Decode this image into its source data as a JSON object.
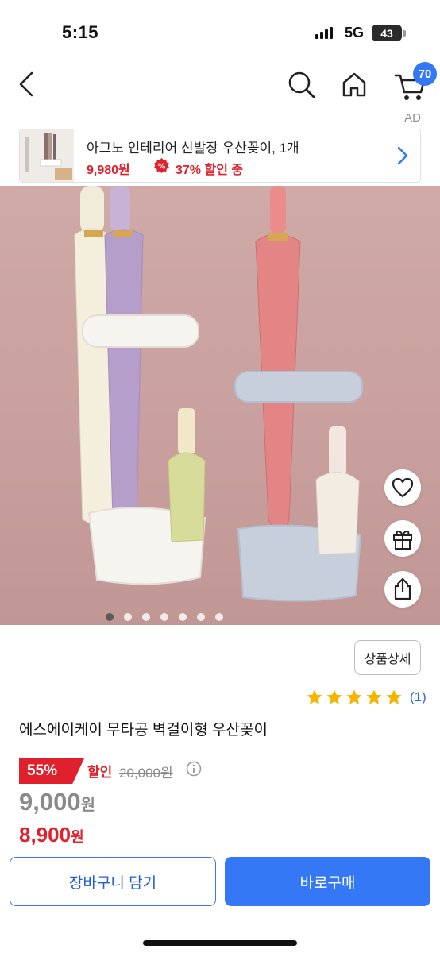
{
  "status_bar": {
    "time": "5:15",
    "network": "5G",
    "battery": "43"
  },
  "nav": {
    "cart_count": "70",
    "ad_label": "AD"
  },
  "ad_banner": {
    "title": "아그노 인테리어 신발장 우산꽂이, 1개",
    "price": "9,980원",
    "discount": "37% 할인 중"
  },
  "carousel": {
    "total_images": 7,
    "current_index": 0
  },
  "detail": {
    "detail_button_label": "상품상세",
    "rating_stars": 5,
    "rating_count": "(1)",
    "product_name": "에스에이케이 무타공 벽걸이형 우산꽂이"
  },
  "pricing": {
    "discount_rate": "55%",
    "sale_label": "할인",
    "original_price": "20,000원",
    "list_price_value": "9,000",
    "list_price_unit": "원",
    "final_price_value": "8,900",
    "final_price_unit": "원"
  },
  "bottom_bar": {
    "add_to_cart_label": "장바구니 담기",
    "buy_now_label": "바로구매"
  },
  "colors": {
    "accent_blue": "#3478f6",
    "sale_red": "#e0212d",
    "star_gold": "#f5b400"
  }
}
